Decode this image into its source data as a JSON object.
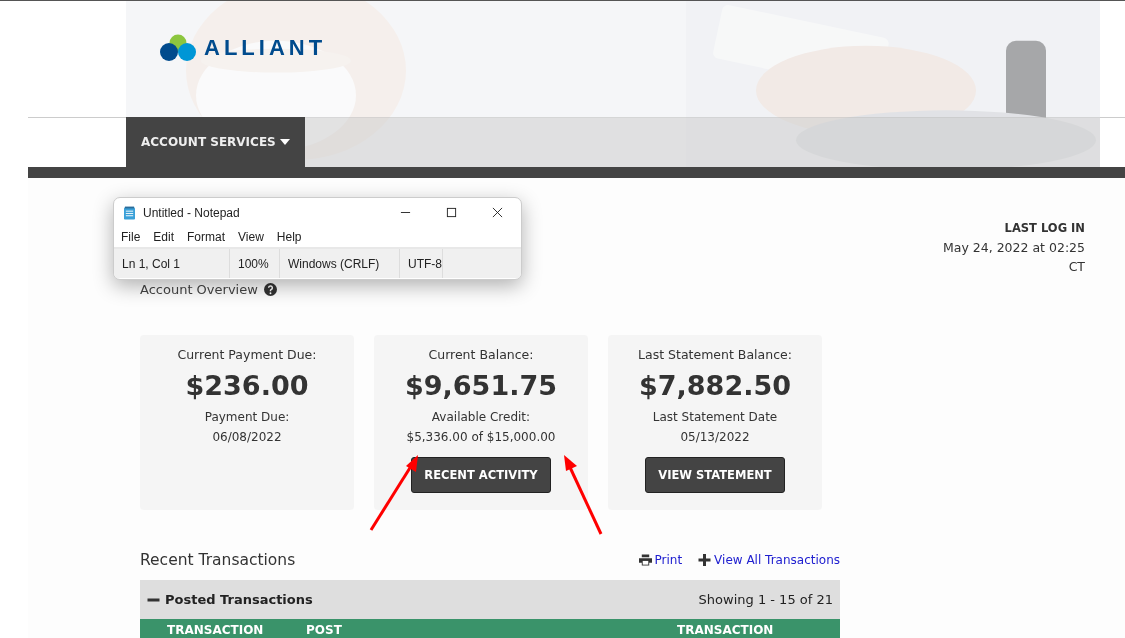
{
  "brand": {
    "name": "ALLIANT"
  },
  "nav": [
    {
      "label": "ACCOUNT SERVICES",
      "selected": true
    }
  ],
  "last_login": {
    "title": "LAST LOG IN",
    "date": "May 24, 2022 at 02:25",
    "zone": "CT"
  },
  "notepad": {
    "title": "Untitled - Notepad",
    "menu": [
      "File",
      "Edit",
      "Format",
      "View",
      "Help"
    ],
    "status": [
      "Ln 1, Col 1",
      "100%",
      "Windows (CRLF)",
      "UTF-8"
    ]
  },
  "overview": {
    "title": "Account Overview"
  },
  "cards": [
    {
      "label": "Current Payment Due:",
      "amount": "$236.00",
      "sub_label": "Payment Due:",
      "sub_value": "06/08/2022"
    },
    {
      "label": "Current Balance:",
      "amount": "$9,651.75",
      "sub_label": "Available Credit:",
      "sub_value": "$5,336.00 of $15,000.00",
      "button": "RECENT ACTIVITY"
    },
    {
      "label": "Last Statement Balance:",
      "amount": "$7,882.50",
      "sub_label": "Last Statement Date",
      "sub_value": "05/13/2022",
      "button": "VIEW STATEMENT"
    }
  ],
  "recent": {
    "title": "Recent Transactions",
    "print": "Print",
    "view_all": "View All Transactions"
  },
  "posted": {
    "title": "Posted Transactions",
    "expanded": true,
    "showing": "Showing 1 - 15 of 21"
  },
  "table": {
    "columns": [
      "TRANSACTION",
      "POST",
      "TRANSACTION"
    ]
  }
}
